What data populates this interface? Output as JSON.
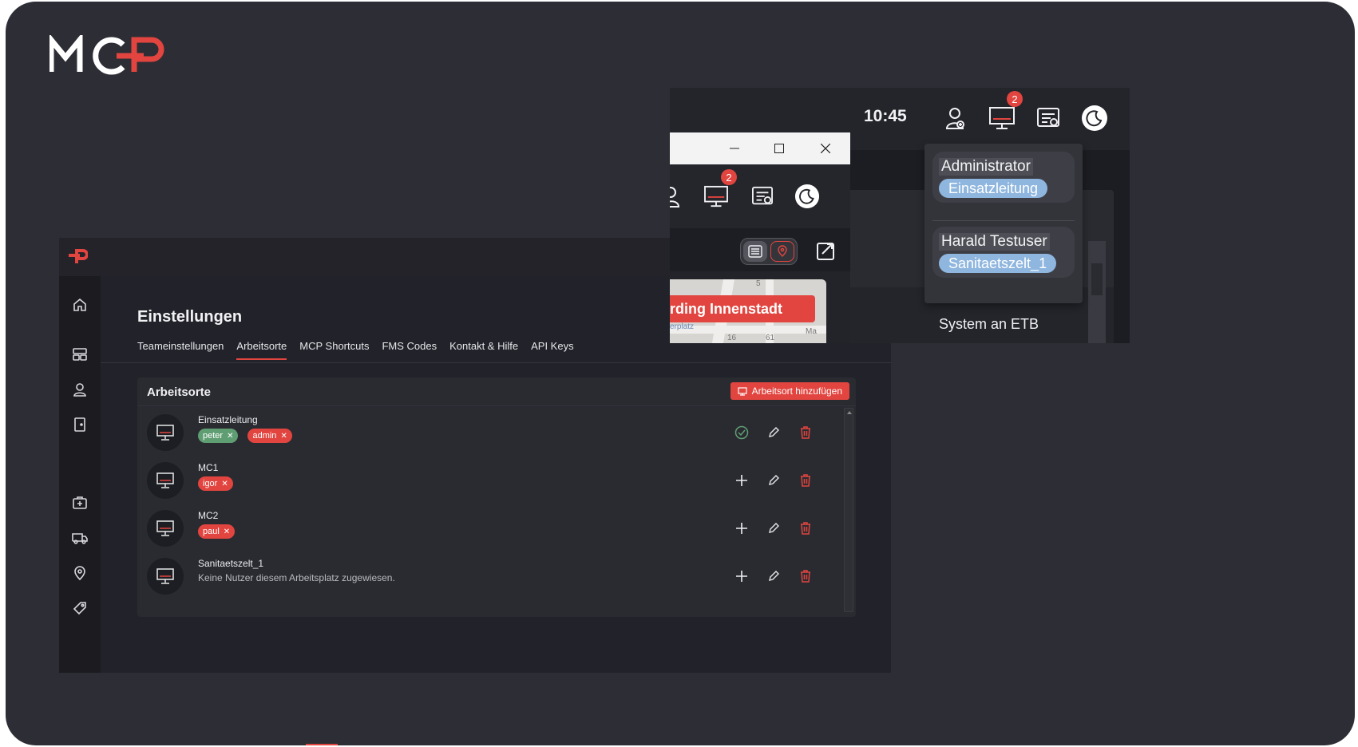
{
  "logo": {
    "text": "MCP"
  },
  "app": {
    "title": "Einstellungen",
    "tabs": [
      {
        "label": "Teameinstellungen",
        "active": false
      },
      {
        "label": "Arbeitsorte",
        "active": true
      },
      {
        "label": "MCP Shortcuts",
        "active": false
      },
      {
        "label": "FMS Codes",
        "active": false
      },
      {
        "label": "Kontakt & Hilfe",
        "active": false
      },
      {
        "label": "API Keys",
        "active": false
      }
    ],
    "sidebar_icons": [
      "home-icon",
      "dashboard-icon",
      "user-badge-icon",
      "exit-door-icon",
      "medical-kit-icon",
      "ambulance-icon",
      "location-pin-icon",
      "tag-icon"
    ],
    "card": {
      "title": "Arbeitsorte",
      "add_button": "Arbeitsort hinzufügen",
      "rows": [
        {
          "name": "Einsatzleitung",
          "users": [
            {
              "label": "peter",
              "color": "green"
            },
            {
              "label": "admin",
              "color": "red"
            }
          ],
          "status": "check"
        },
        {
          "name": "MC1",
          "users": [
            {
              "label": "igor",
              "color": "red"
            }
          ],
          "status": "plus"
        },
        {
          "name": "MC2",
          "users": [
            {
              "label": "paul",
              "color": "red"
            }
          ],
          "status": "plus"
        },
        {
          "name": "Sanitaetszelt_1",
          "users": [],
          "empty_text": "Keine Nutzer diesem Arbeitsplatz zugewiesen.",
          "status": "plus"
        }
      ]
    }
  },
  "overlay": {
    "clock": "10:45",
    "monitor_badge": "2",
    "dropdown": [
      {
        "name": "Administrator",
        "location": "Einsatzleitung"
      },
      {
        "name": "Harald Testuser",
        "location": "Sanitaetszelt_1"
      }
    ],
    "system_text": "System an ETB",
    "inner_window": {
      "badge": "2",
      "map_label": "rding Innenstadt",
      "map_street": "erplatz",
      "map_numbers": [
        "5",
        "16",
        "61",
        "Ma"
      ]
    }
  },
  "colors": {
    "accent": "#e2453f",
    "green_chip": "#5f9e73",
    "location_chip": "#8fb6de",
    "background": "#2d2e35"
  }
}
